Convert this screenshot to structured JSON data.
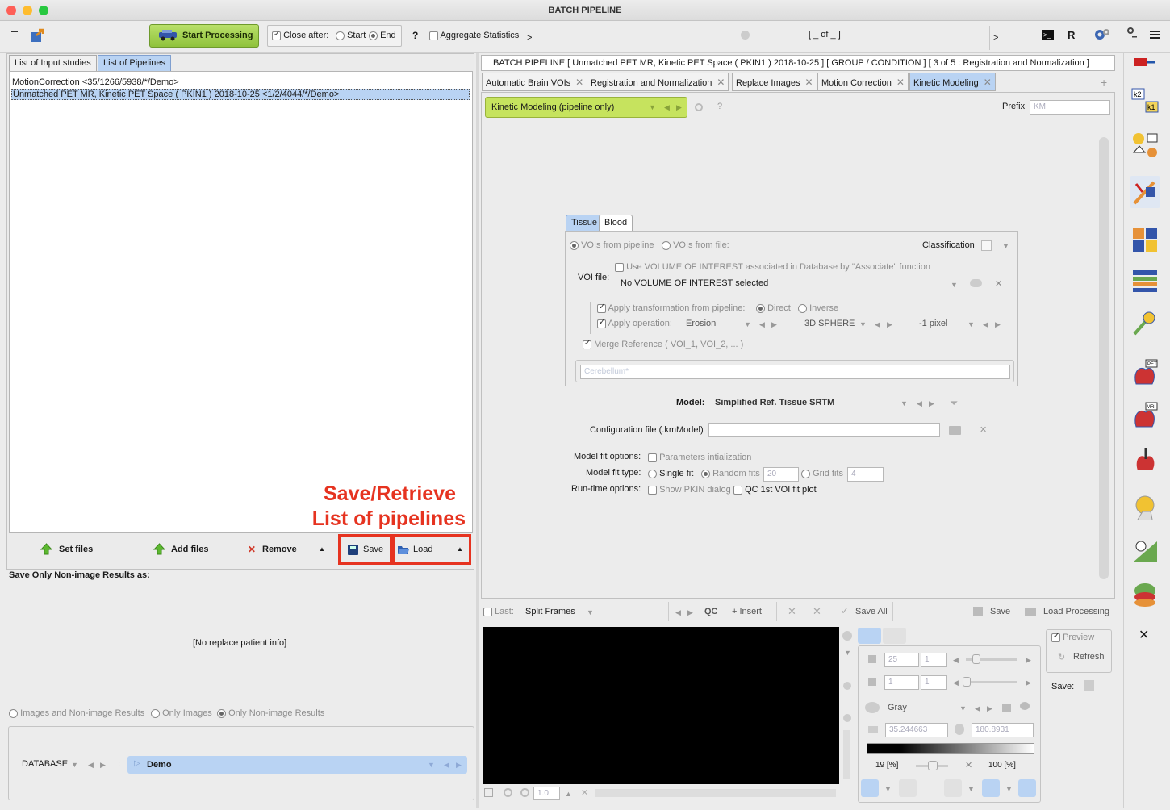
{
  "window": {
    "title": "BATCH PIPELINE"
  },
  "toolbar": {
    "start_label": "Start Processing",
    "close_after_label": "Close after:",
    "start_option": "Start",
    "end_option": "End",
    "help": "?",
    "aggregate_label": "Aggregate Statistics",
    "more": ">",
    "counter": "[ _ of _ ]",
    "more2": ">",
    "r_label": "R"
  },
  "left": {
    "tabs": [
      "List of Input studies",
      "List of Pipelines"
    ],
    "pipelines": [
      "MotionCorrection <35/1266/5938/*/Demo>",
      "Unmatched PET MR, Kinetic PET Space ( PKIN1 ) 2018-10-25 <1/2/4044/*/Demo>"
    ],
    "annotation_line1": "Save/Retrieve",
    "annotation_line2": "List of pipelines",
    "set_files": "Set files",
    "add_files": "Add files",
    "remove": "Remove",
    "save": "Save",
    "load": "Load",
    "save_only_label": "Save Only Non-image Results as:",
    "no_replace": "[No replace patient info]",
    "radio_images_nonimage": "Images and Non-image Results",
    "radio_only_images": "Only Images",
    "radio_only_nonimage": "Only Non-image Results",
    "database_label": "DATABASE",
    "db_colon": ":",
    "db_value": "Demo"
  },
  "right": {
    "header": "BATCH PIPELINE   [ Unmatched PET MR, Kinetic PET Space ( PKIN1 ) 2018-10-25  ]   [ GROUP / CONDITION ]   [ 3 of 5 : Registration and Normalization ]",
    "tabs": [
      "Automatic Brain VOIs",
      "Registration and Normalization",
      "Replace Images",
      "Motion Correction",
      "Kinetic Modeling"
    ],
    "add_tab": "+",
    "module_select": "Kinetic Modeling (pipeline only)",
    "module_help": "?",
    "prefix_label": "Prefix",
    "prefix_value": "KM",
    "subtabs": [
      "Tissue",
      "Blood"
    ],
    "vois_from_pipeline": "VOIs from pipeline",
    "vois_from_file": "VOIs from file:",
    "classification": "Classification",
    "use_voi_assoc": "Use VOLUME OF INTEREST associated in Database by \"Associate\" function",
    "voi_file_label": "VOI file:",
    "voi_file_value": "No VOLUME OF INTEREST selected",
    "apply_transform": "Apply transformation from pipeline:",
    "direct": "Direct",
    "inverse": "Inverse",
    "apply_operation": "Apply operation:",
    "operation": "Erosion",
    "shape": "3D SPHERE",
    "pixels": "-1 pixel",
    "merge_reference": "Merge Reference ( VOI_1, VOI_2, ... )",
    "merge_placeholder": "Cerebellum*",
    "model_label": "Model:",
    "model_value": "Simplified Ref. Tissue SRTM",
    "config_label": "Configuration file (.kmModel)",
    "fit_options_label": "Model fit options:",
    "params_init": "Parameters intialization",
    "fit_type_label": "Model fit type:",
    "single_fit": "Single fit",
    "random_fits": "Random fits",
    "random_fits_val": "20",
    "grid_fits": "Grid fits",
    "grid_fits_val": "4",
    "runtime_label": "Run-time options:",
    "show_pkin": "Show PKIN dialog",
    "qc_plot": "QC 1st VOI fit plot"
  },
  "bottom": {
    "last_label": "Last:",
    "split_frames": "Split Frames",
    "qc": "QC",
    "insert": "+ Insert",
    "save_all": "Save All",
    "save": "Save",
    "load_processing": "Load Processing",
    "zoom_value": "1.0",
    "val1a": "25",
    "val1b": "1",
    "val2a": "1",
    "val2b": "1",
    "colormap": "Gray",
    "min_value": "35.244663",
    "max_value": "180.8931",
    "pct_low": "19",
    "pct_unit": "[%]",
    "pct_high": "100",
    "preview": "Preview",
    "refresh": "Refresh",
    "save_label": "Save:"
  },
  "colors": {
    "accent": "#b9d3f3",
    "green_button": "#9ccb46",
    "annotation": "#e63320",
    "module_bar": "#c6e35e"
  }
}
